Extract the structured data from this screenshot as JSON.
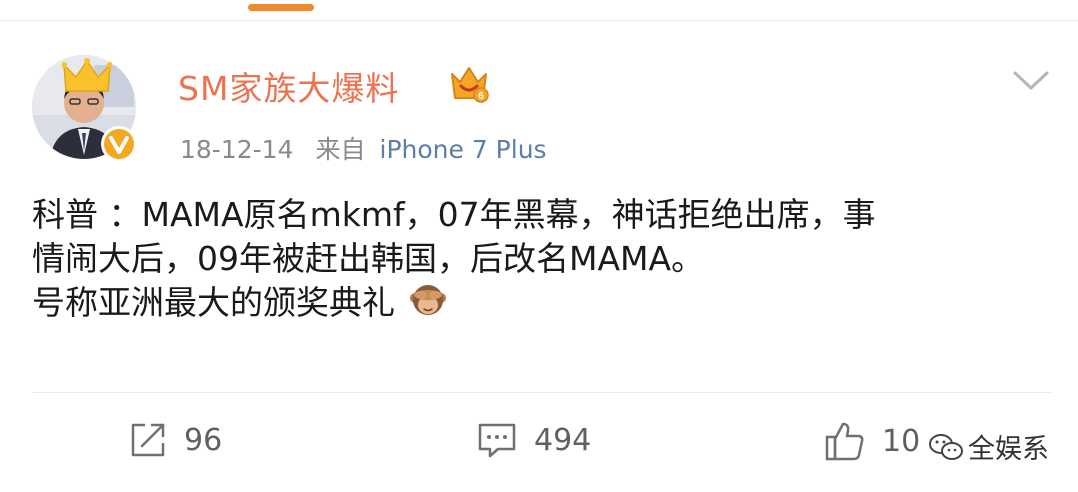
{
  "post": {
    "username": "SM家族大爆料",
    "date": "18-12-14",
    "source_prefix": "来自",
    "device": "iPhone 7 Plus",
    "text_lines": [
      "科普 ：MAMA原名mkmf，07年黑幕，神话拒绝出席，事",
      "情闹大后，09年被赶出韩国，后改名MAMA。",
      "号称亚洲最大的颁奖典礼"
    ],
    "emoji_name": "see-no-evil-monkey"
  },
  "actions": {
    "repost_count": "96",
    "comment_count": "494",
    "like_count": "10"
  },
  "watermark": {
    "text": "全娱系"
  },
  "icons": {
    "avatar_crown": "crown-icon",
    "verified": "verified-badge-icon",
    "vip": "vip-crown-icon",
    "more": "chevron-down-icon",
    "repost": "repost-icon",
    "comment": "comment-icon",
    "like": "thumbs-up-icon",
    "watermark": "wechat-icon"
  },
  "colors": {
    "username": "#eb7350",
    "accent_bar": "#f08a2b",
    "device": "#5b7fa8",
    "meta": "#8a8a8a",
    "verified": "#f5a623"
  }
}
